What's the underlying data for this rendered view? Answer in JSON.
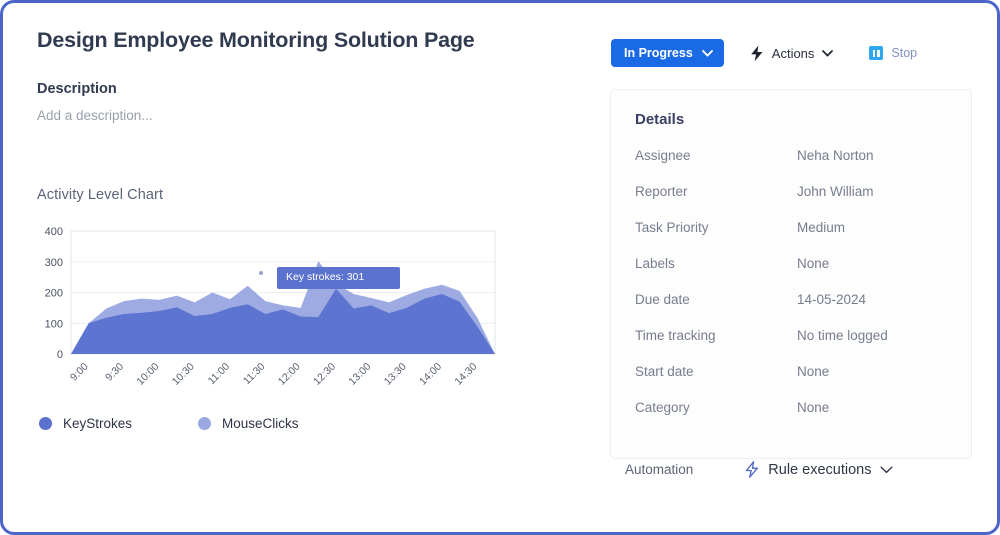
{
  "task": {
    "title": "Design Employee Monitoring Solution Page",
    "description_heading": "Description",
    "description_placeholder": "Add a description..."
  },
  "action_bar": {
    "status_label": "In Progress",
    "status_color": "#1a6ae6",
    "status_chevron_icon": "chevron-down-icon",
    "actions_label": "Actions",
    "actions_icon": "lightning-bolt-icon",
    "actions_chevron_icon": "chevron-down-icon",
    "stop_label": "Stop",
    "stop_icon": "pause-icon",
    "stop_color": "#2ea7ef"
  },
  "details": {
    "heading": "Details",
    "rows": [
      {
        "label": "Assignee",
        "value": "Neha Norton"
      },
      {
        "label": "Reporter",
        "value": "John William"
      },
      {
        "label": "Task Priority",
        "value": "Medium"
      },
      {
        "label": "Labels",
        "value": "None"
      },
      {
        "label": "Due date",
        "value": "14-05-2024"
      },
      {
        "label": "Time tracking",
        "value": "No time logged"
      },
      {
        "label": "Start date",
        "value": "None"
      },
      {
        "label": "Category",
        "value": "None"
      }
    ]
  },
  "automation": {
    "label": "Automation",
    "rule_executions_label": "Rule executions",
    "rule_icon": "lightning-bolt-outline-icon",
    "chevron_icon": "chevron-down-icon"
  },
  "chart_data": {
    "type": "area",
    "title": "Activity Level Chart",
    "xlabel": "",
    "ylabel": "",
    "ylim": [
      0,
      400
    ],
    "y_ticks": [
      0,
      100,
      200,
      300,
      400
    ],
    "grid": true,
    "stacked": false,
    "legend_position": "bottom-left",
    "x": [
      "9:00",
      "9:30",
      "10:00",
      "10:30",
      "11:00",
      "11:30",
      "12:00",
      "12:30",
      "13:00",
      "13:30",
      "14:00",
      "14:30"
    ],
    "x_tick_rotation": -45,
    "series": [
      {
        "name": "KeyStrokes",
        "color": "#5b71d0",
        "values": [
          0,
          100,
          118,
          130,
          134,
          140,
          152,
          123,
          130,
          150,
          162,
          130,
          145,
          122,
          120,
          212,
          148,
          158,
          133,
          150,
          180,
          195,
          170,
          90,
          0
        ]
      },
      {
        "name": "MouseClicks",
        "color": "#9aa8e2",
        "values": [
          0,
          100,
          148,
          172,
          180,
          176,
          190,
          168,
          200,
          178,
          222,
          172,
          158,
          150,
          302,
          228,
          195,
          182,
          168,
          192,
          212,
          225,
          205,
          118,
          0
        ]
      }
    ],
    "tooltip": {
      "text": "Key strokes: 301",
      "series": "KeyStrokes",
      "value": 301,
      "background": "#5c72cf",
      "text_color": "#ffffff"
    }
  }
}
